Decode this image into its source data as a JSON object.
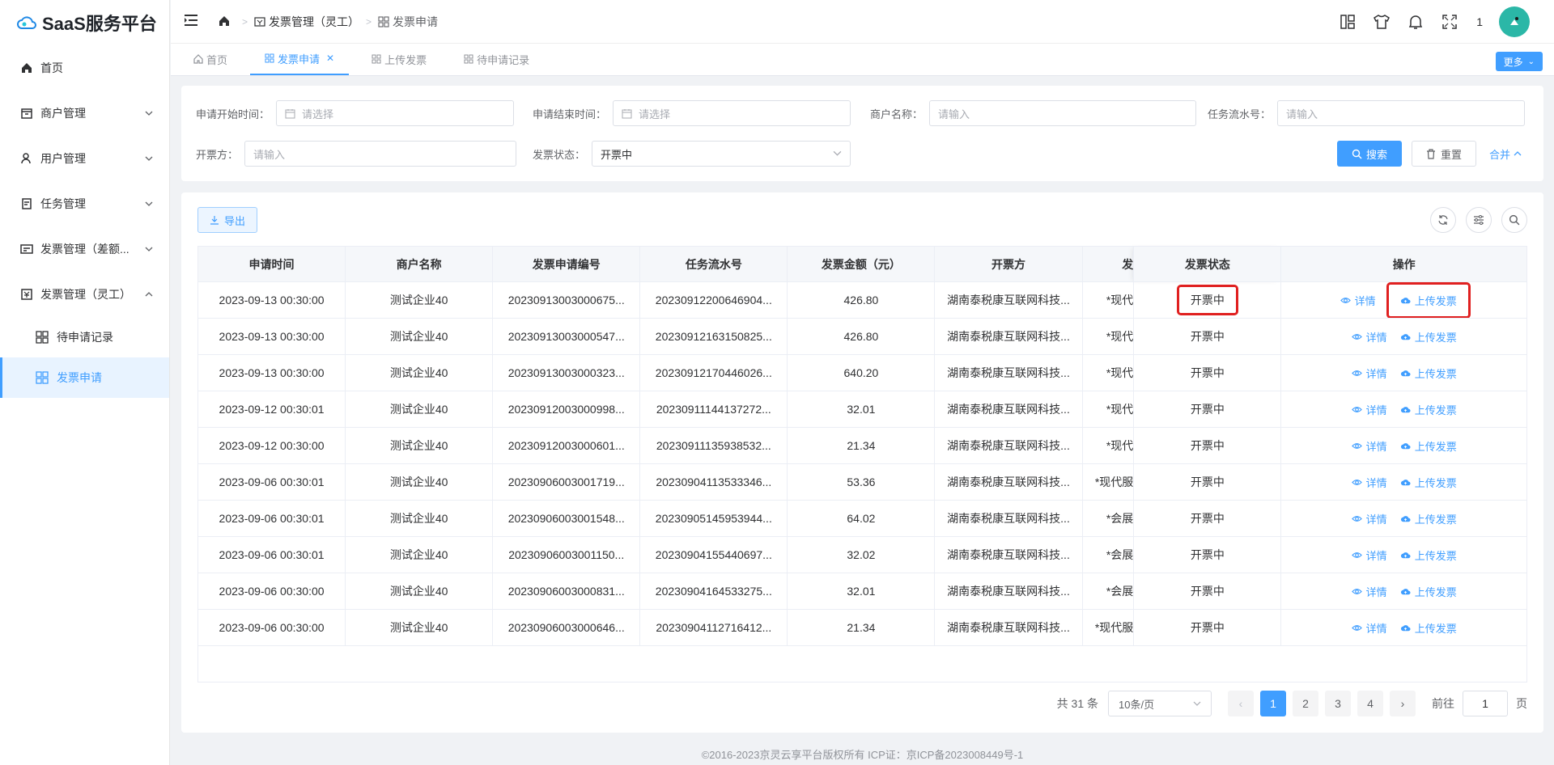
{
  "app": {
    "title": "SaaS服务平台"
  },
  "sidebar": {
    "items": [
      {
        "label": "首页",
        "icon": "home-icon"
      },
      {
        "label": "商户管理",
        "icon": "store-icon"
      },
      {
        "label": "用户管理",
        "icon": "user-icon"
      },
      {
        "label": "任务管理",
        "icon": "task-icon"
      },
      {
        "label": "发票管理（差额...",
        "icon": "invoice-icon"
      },
      {
        "label": "发票管理（灵工）",
        "icon": "invoice-icon"
      }
    ],
    "sub_items": [
      {
        "label": "待申请记录"
      },
      {
        "label": "发票申请"
      }
    ]
  },
  "header": {
    "breadcrumb": [
      "发票管理（灵工）",
      "发票申请"
    ],
    "notify_count": "1"
  },
  "tabs": [
    {
      "label": "首页"
    },
    {
      "label": "发票申请"
    },
    {
      "label": "上传发票"
    },
    {
      "label": "待申请记录"
    }
  ],
  "more_label": "更多",
  "filters": {
    "start_label": "申请开始时间：",
    "start_placeholder": "请选择",
    "end_label": "申请结束时间：",
    "end_placeholder": "请选择",
    "merchant_label": "商户名称：",
    "merchant_placeholder": "请输入",
    "serial_label": "任务流水号：",
    "serial_placeholder": "请输入",
    "issuer_label": "开票方：",
    "issuer_placeholder": "请输入",
    "status_label": "发票状态：",
    "status_value": "开票中",
    "search_label": "搜索",
    "reset_label": "重置",
    "collapse_label": "合并"
  },
  "table": {
    "export_label": "导出",
    "columns": [
      "申请时间",
      "商户名称",
      "发票申请编号",
      "任务流水号",
      "发票金额（元）",
      "开票方",
      "发",
      "发票状态",
      "操作"
    ],
    "detail_label": "详情",
    "upload_label": "上传发票",
    "rows": [
      [
        "2023-09-13 00:30:00",
        "测试企业40",
        "20230913003000675...",
        "20230912200646904...",
        "426.80",
        "湖南泰税康互联网科技...",
        "*现代",
        "开票中"
      ],
      [
        "2023-09-13 00:30:00",
        "测试企业40",
        "20230913003000547...",
        "20230912163150825...",
        "426.80",
        "湖南泰税康互联网科技...",
        "*现代",
        "开票中"
      ],
      [
        "2023-09-13 00:30:00",
        "测试企业40",
        "20230913003000323...",
        "20230912170446026...",
        "640.20",
        "湖南泰税康互联网科技...",
        "*现代",
        "开票中"
      ],
      [
        "2023-09-12 00:30:01",
        "测试企业40",
        "20230912003000998...",
        "20230911144137272...",
        "32.01",
        "湖南泰税康互联网科技...",
        "*现代",
        "开票中"
      ],
      [
        "2023-09-12 00:30:00",
        "测试企业40",
        "20230912003000601...",
        "20230911135938532...",
        "21.34",
        "湖南泰税康互联网科技...",
        "*现代",
        "开票中"
      ],
      [
        "2023-09-06 00:30:01",
        "测试企业40",
        "20230906003001719...",
        "20230904113533346...",
        "53.36",
        "湖南泰税康互联网科技...",
        "*现代服",
        "开票中"
      ],
      [
        "2023-09-06 00:30:01",
        "测试企业40",
        "20230906003001548...",
        "20230905145953944...",
        "64.02",
        "湖南泰税康互联网科技...",
        "*会展",
        "开票中"
      ],
      [
        "2023-09-06 00:30:01",
        "测试企业40",
        "20230906003001150...",
        "20230904155440697...",
        "32.02",
        "湖南泰税康互联网科技...",
        "*会展",
        "开票中"
      ],
      [
        "2023-09-06 00:30:00",
        "测试企业40",
        "20230906003000831...",
        "20230904164533275...",
        "32.01",
        "湖南泰税康互联网科技...",
        "*会展",
        "开票中"
      ],
      [
        "2023-09-06 00:30:00",
        "测试企业40",
        "20230906003000646...",
        "20230904112716412...",
        "21.34",
        "湖南泰税康互联网科技...",
        "*现代服",
        "开票中"
      ]
    ]
  },
  "pagination": {
    "total": "共 31 条",
    "page_size": "10条/页",
    "pages": [
      "1",
      "2",
      "3",
      "4"
    ],
    "goto_label": "前往",
    "goto_value": "1",
    "page_suffix": "页"
  },
  "footer": "©2016-2023京灵云享平台版权所有 ICP证：京ICP备2023008449号-1"
}
